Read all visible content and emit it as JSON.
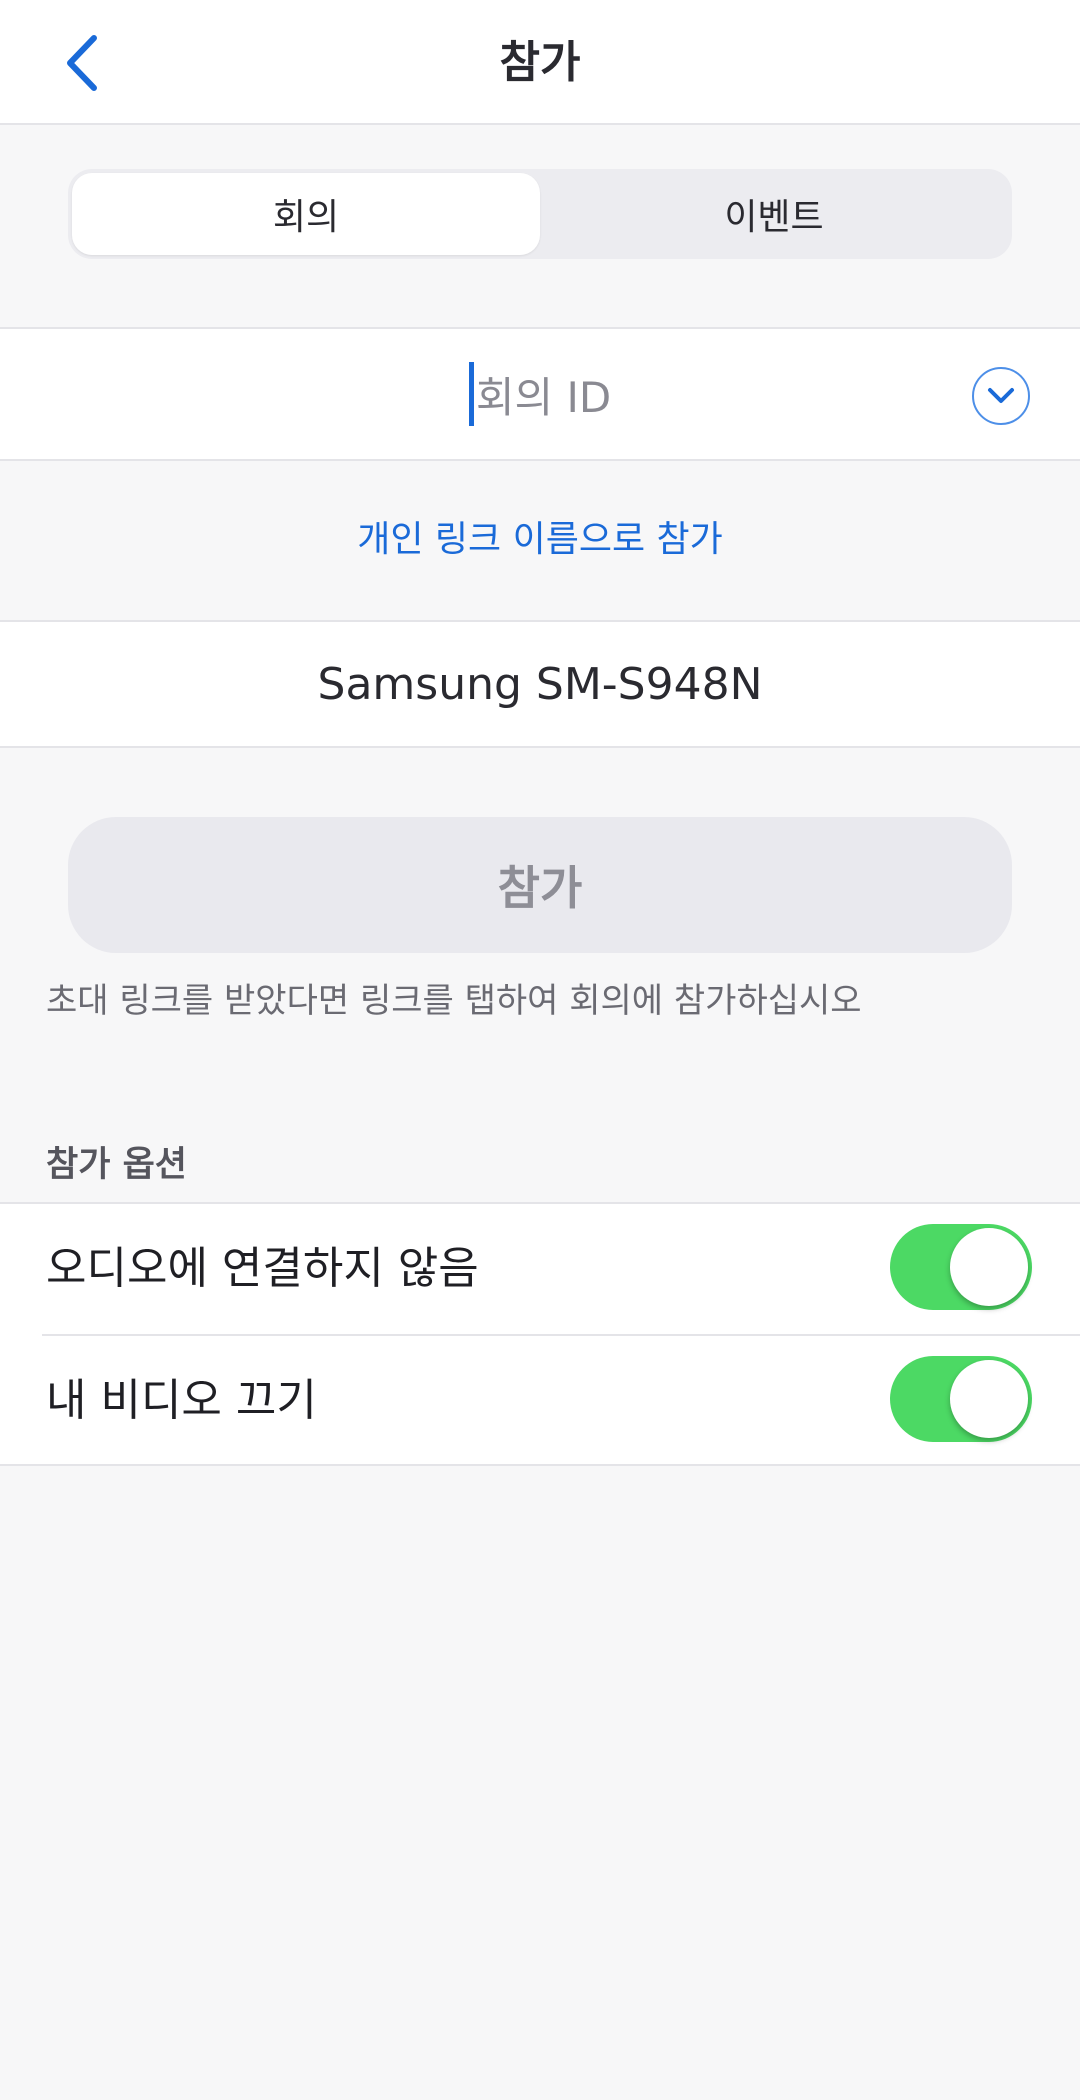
{
  "header": {
    "title": "참가",
    "back_icon": "chevron-left-icon"
  },
  "tabs": [
    {
      "label": "회의",
      "selected": true
    },
    {
      "label": "이벤트",
      "selected": false
    }
  ],
  "meeting_id": {
    "placeholder": "회의 ID",
    "value": "",
    "dropdown_icon": "chevron-down-circle-icon"
  },
  "personal_link_label": "개인 링크 이름으로 참가",
  "display_name": {
    "value": "Samsung SM-S948N"
  },
  "join_button": {
    "label": "참가",
    "enabled": false
  },
  "hint": "초대 링크를 받았다면 링크를 탭하여 회의에 참가하십시오",
  "options": {
    "section_label": "참가 옵션",
    "items": [
      {
        "label": "오디오에 연결하지 않음",
        "on": true
      },
      {
        "label": "내 비디오 끄기",
        "on": true
      }
    ]
  },
  "colors": {
    "accent": "#1a6ad8",
    "toggle_on": "#4cd964",
    "background": "#f7f7f8"
  }
}
